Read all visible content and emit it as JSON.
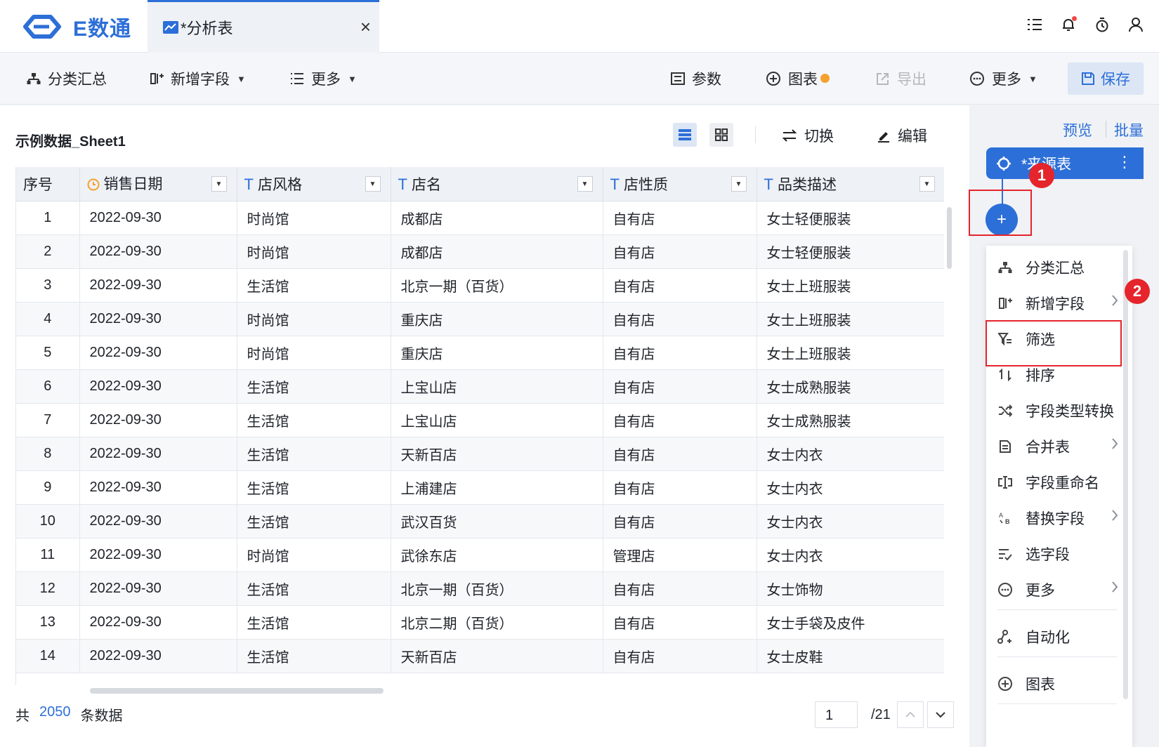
{
  "app": {
    "logo_text": "E数通",
    "brand_color": "#2d6fd8"
  },
  "tab": {
    "label": "*分析表",
    "close": "×"
  },
  "top_icons": [
    "list-icon",
    "bell-icon",
    "timer-icon",
    "user-icon"
  ],
  "toolbar": {
    "group_summary": "分类汇总",
    "add_field": "新增字段",
    "more_left": "更多",
    "params": "参数",
    "chart": "图表",
    "export": "导出",
    "more_right": "更多",
    "save": "保存"
  },
  "sheet": {
    "title": "示例数据_Sheet1",
    "switch": "切换",
    "edit": "编辑"
  },
  "table": {
    "columns": [
      "序号",
      "销售日期",
      "店风格",
      "店名",
      "店性质",
      "品类描述"
    ],
    "rows": [
      [
        "1",
        "2022-09-30",
        "时尚馆",
        "成都店",
        "自有店",
        "女士轻便服装"
      ],
      [
        "2",
        "2022-09-30",
        "时尚馆",
        "成都店",
        "自有店",
        "女士轻便服装"
      ],
      [
        "3",
        "2022-09-30",
        "生活馆",
        "北京一期（百货）",
        "自有店",
        "女士上班服装"
      ],
      [
        "4",
        "2022-09-30",
        "时尚馆",
        "重庆店",
        "自有店",
        "女士上班服装"
      ],
      [
        "5",
        "2022-09-30",
        "时尚馆",
        "重庆店",
        "自有店",
        "女士上班服装"
      ],
      [
        "6",
        "2022-09-30",
        "生活馆",
        "上宝山店",
        "自有店",
        "女士成熟服装"
      ],
      [
        "7",
        "2022-09-30",
        "生活馆",
        "上宝山店",
        "自有店",
        "女士成熟服装"
      ],
      [
        "8",
        "2022-09-30",
        "生活馆",
        "天新百店",
        "自有店",
        "女士内衣"
      ],
      [
        "9",
        "2022-09-30",
        "生活馆",
        "上浦建店",
        "自有店",
        "女士内衣"
      ],
      [
        "10",
        "2022-09-30",
        "生活馆",
        "武汉百货",
        "自有店",
        "女士内衣"
      ],
      [
        "11",
        "2022-09-30",
        "时尚馆",
        "武徐东店",
        "管理店",
        "女士内衣"
      ],
      [
        "12",
        "2022-09-30",
        "生活馆",
        "北京一期（百货）",
        "自有店",
        "女士饰物"
      ],
      [
        "13",
        "2022-09-30",
        "生活馆",
        "北京二期（百货）",
        "自有店",
        "女士手袋及皮件"
      ],
      [
        "14",
        "2022-09-30",
        "生活馆",
        "天新百店",
        "自有店",
        "女士皮鞋"
      ]
    ]
  },
  "footer": {
    "count_prefix": "共",
    "count": "2050",
    "count_suffix": "条数据",
    "page": "1",
    "total_pages": "/21"
  },
  "flow": {
    "preview": "预览",
    "batch": "批量",
    "source_node": "*来源表",
    "add": "+",
    "badge1": "1",
    "badge2": "2",
    "menu": [
      {
        "label": "分类汇总",
        "icon": "group-icon",
        "submenu": false
      },
      {
        "label": "新增字段",
        "icon": "add-field-icon",
        "submenu": true
      },
      {
        "label": "筛选",
        "icon": "filter-icon",
        "submenu": false
      },
      {
        "label": "排序",
        "icon": "sort-icon",
        "submenu": false
      },
      {
        "label": "字段类型转换",
        "icon": "shuffle-icon",
        "submenu": false
      },
      {
        "label": "合并表",
        "icon": "merge-table-icon",
        "submenu": true
      },
      {
        "label": "字段重命名",
        "icon": "rename-icon",
        "submenu": false
      },
      {
        "label": "替换字段",
        "icon": "replace-icon",
        "submenu": true
      },
      {
        "label": "选字段",
        "icon": "select-field-icon",
        "submenu": false
      },
      {
        "label": "更多",
        "icon": "more-icon",
        "submenu": true
      },
      {
        "label": "自动化",
        "icon": "automation-icon",
        "submenu": false
      },
      {
        "label": "图表",
        "icon": "chart-add-icon",
        "submenu": false
      }
    ]
  },
  "colors": {
    "accent": "#2d6fd8",
    "highlight": "#e5242b",
    "warning": "#f4a12e"
  }
}
